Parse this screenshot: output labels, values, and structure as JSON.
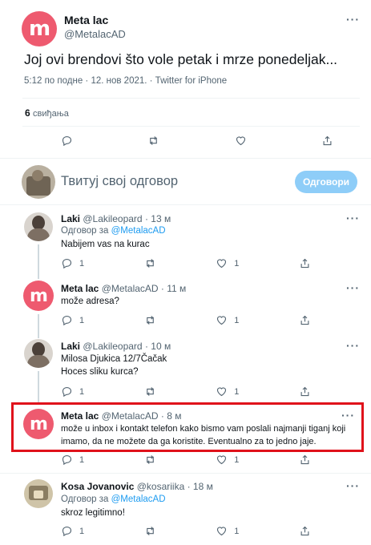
{
  "main_tweet": {
    "author_name": "Meta lac",
    "author_handle": "@MetalacAD",
    "avatar_mark": "m",
    "text": "Joj ovi brendovi što vole petak i mrze ponedeljak...",
    "meta": "5:12 по подне · 12. нов 2021. · Twitter for iPhone",
    "likes_count": "6",
    "likes_label": "свиђања",
    "more_label": "···"
  },
  "compose": {
    "placeholder": "Твитуј свој одговор",
    "button_label": "Одговори"
  },
  "replies": [
    {
      "name": "Laki",
      "handle": "@Lakileopard",
      "time": "· 13 м",
      "reply_prefix": "Одговор за",
      "reply_to": "@MetalacAD",
      "lines": [
        "Nabijem vas na kurac"
      ],
      "reply_count": "1",
      "like_count": "1",
      "more": "···"
    },
    {
      "name": "Meta lac",
      "handle": "@MetalacAD",
      "time": "· 11 м",
      "lines": [
        "može adresa?"
      ],
      "reply_count": "1",
      "like_count": "1",
      "more": "···"
    },
    {
      "name": "Laki",
      "handle": "@Lakileopard",
      "time": "· 10 м",
      "lines": [
        "Milosa Djukica 12/7Čačak",
        "Hoces sliku kurca?"
      ],
      "reply_count": "1",
      "like_count": "1",
      "more": "···"
    },
    {
      "name": "Meta lac",
      "handle": "@MetalacAD",
      "time": "· 8 м",
      "lines": [
        "može u inbox i kontakt telefon kako bismo vam poslali najmanji tiganj koji",
        "imamo, da ne možete da ga koristite. Eventualno za to jedno jaje."
      ],
      "reply_count": "1",
      "like_count": "1",
      "more": "···"
    },
    {
      "name": "Kosa Jovanovic",
      "handle": "@kosariika",
      "time": "· 18 м",
      "reply_prefix": "Одговор за",
      "reply_to": "@MetalacAD",
      "lines": [
        "skroz legitimno!"
      ],
      "reply_count": "1",
      "like_count": "1",
      "more": "···"
    }
  ],
  "colors": {
    "highlight_border": "#e0121b",
    "brand": "#ee5a6f",
    "link": "#1d9bf0",
    "button_disabled": "#8ecdf8"
  }
}
